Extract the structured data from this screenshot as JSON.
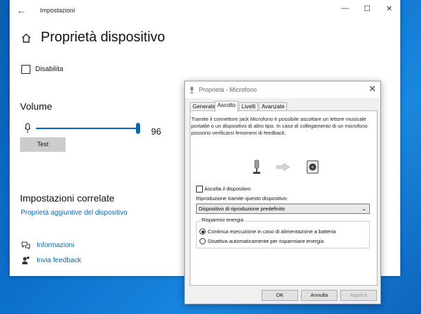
{
  "settings_window": {
    "title": "Impostazioni",
    "back_icon": "back-arrow-icon",
    "controls": {
      "minimize": "—",
      "maximize": "☐",
      "close": "✕"
    },
    "page_title": "Proprietà dispositivo",
    "disable_label": "Disabilita",
    "volume": {
      "heading": "Volume",
      "value": "96",
      "level": 0.96,
      "test_label": "Test"
    },
    "related": {
      "heading": "Impostazioni correlate",
      "link": "Proprietà aggiuntive del dispositivo"
    },
    "info_link": "Informazioni",
    "feedback_link": "Invia feedback"
  },
  "properties_dialog": {
    "title": "Proprietà - Microfono",
    "close": "✕",
    "tabs": [
      "Generale",
      "Ascolto",
      "Livelli",
      "Avanzate"
    ],
    "active_tab": "Ascolto",
    "description": "Tramite il connettore jack Microfono è possibile ascoltare un lettore musicale portatile o un dispositivo di altro tipo. In caso di collegamento di un microfono possono verificarsi fenomeni di feedback.",
    "listen_label": "Ascolta il dispositivo",
    "playback_label": "Riproduzione tramite questo dispositivo:",
    "playback_value": "Dispositivo di riproduzione predefinito",
    "power": {
      "legend": "Risparmio energia",
      "option1": "Continua esecuzione in caso di alimentazione a batteria",
      "option2": "Disattiva automaticamente per risparmiare energia"
    },
    "buttons": {
      "ok": "OK",
      "cancel": "Annulla",
      "apply": "Applica"
    }
  }
}
